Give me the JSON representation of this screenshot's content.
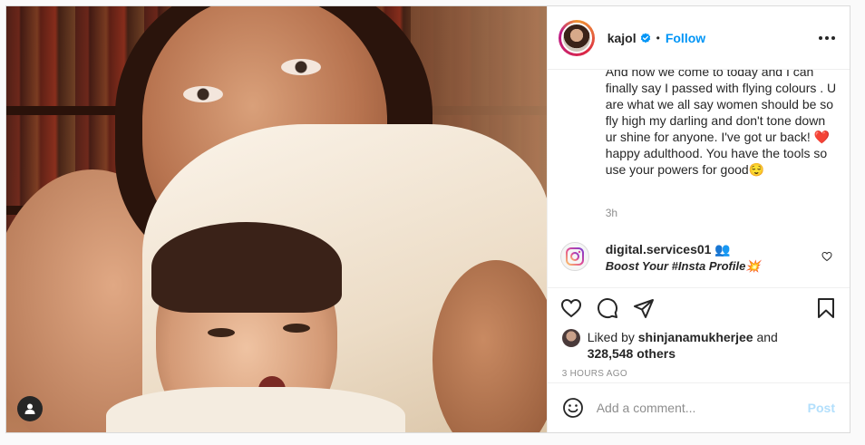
{
  "header": {
    "username": "kajol",
    "separator": "•",
    "follow_label": "Follow"
  },
  "caption": {
    "text": "And now we come to today and I can finally say I passed with flying colours . U are what we all say women should be so fly high my darling and don't tone down ur shine for anyone. I've got ur back! ❤️happy adulthood. You have the tools so use your powers for good😌",
    "time": "3h"
  },
  "comment": {
    "username": "digital.services01 👥",
    "text": "Boost Your #Insta Profile💥"
  },
  "likes": {
    "prefix": "Liked by ",
    "user": "shinjanamukherjee",
    "middle": " and",
    "count": "328,548 others"
  },
  "post_age": "3 HOURS AGO",
  "add_comment": {
    "placeholder": "Add a comment...",
    "post_label": "Post"
  },
  "colors": {
    "accent": "#0095f6",
    "post_disabled": "#b2dffc",
    "heart": "#ed4956"
  }
}
